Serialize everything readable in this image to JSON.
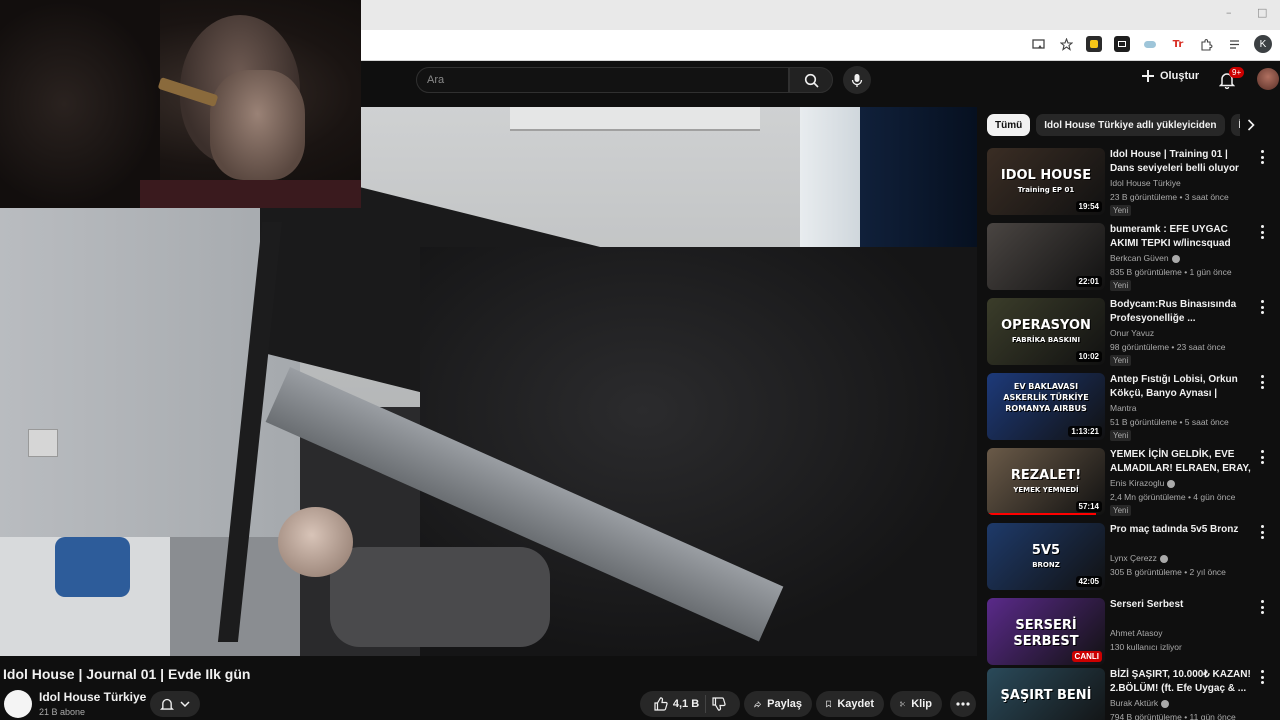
{
  "browser": {
    "window_controls": [
      "–",
      "□"
    ],
    "profile_initial": "K",
    "extensions": [
      "cast-icon",
      "star-icon",
      "ext-yellow-icon",
      "ext-dark-icon",
      "ext-cloud-icon",
      "ext-red-icon",
      "puzzle-icon",
      "tabs-icon"
    ]
  },
  "header": {
    "search_placeholder": "Ara",
    "create_label": "Oluştur",
    "notifications_badge": "9+"
  },
  "video": {
    "title": "Idol House | Journal 01 | Evde Ilk gün",
    "channel": "Idol House Türkiye",
    "subscribers": "21 B abone",
    "likes": "4,1 B",
    "share_label": "Paylaş",
    "save_label": "Kaydet",
    "clip_label": "Klip"
  },
  "sidebar": {
    "chips": [
      "Tümü",
      "Idol House Türkiye adlı yükleyiciden",
      "İl"
    ],
    "recommendations": [
      {
        "title": "Idol House | Training 01 | Dans seviyeleri belli oluyor",
        "channel": "Idol House Türkiye",
        "verified": false,
        "meta": "23 B görüntüleme • 3 saat önce",
        "badge": "Yeni",
        "duration": "19:54",
        "thumb_text": "IDOL HOUSE",
        "thumb_sub": "Training EP 01",
        "thumb_bg": "#3a2d24"
      },
      {
        "title": "bumeramk : EFE UYGAC AKIMI TEPKI w/lincsquad",
        "channel": "Berkcan Güven",
        "verified": true,
        "meta": "835 B görüntüleme • 1 gün önce",
        "badge": "Yeni",
        "duration": "22:01",
        "thumb_text": "",
        "thumb_sub": "",
        "thumb_bg": "#4a4542"
      },
      {
        "title": "Bodycam:Rus Binasısında Profesyonelliğe ...",
        "channel": "Onur Yavuz",
        "verified": false,
        "meta": "98 görüntüleme • 23 saat önce",
        "badge": "Yeni",
        "duration": "10:02",
        "thumb_text": "OPERASYON",
        "thumb_sub": "FABRİKA BASKINI",
        "thumb_bg": "#3b3d2a"
      },
      {
        "title": "Antep Fıstığı Lobisi, Orkun Kökçü, Banyo Aynası | Harman...",
        "channel": "Mantra",
        "verified": false,
        "meta": "51 B görüntüleme • 5 saat önce",
        "badge": "Yeni",
        "duration": "1:13:21",
        "thumb_text": "EV BAKLAVASI ASKERLİK TÜRKİYE ROMANYA AIRBUS",
        "thumb_sub": "",
        "thumb_bg": "#1d3a7a"
      },
      {
        "title": "YEMEK İÇİN GELDİK, EVE ALMADILAR! ELRAEN, ERAY, ...",
        "channel": "Enis Kirazoglu",
        "verified": true,
        "meta": "2,4 Mn görüntüleme • 4 gün önce",
        "badge": "Yeni",
        "duration": "57:14",
        "thumb_text": "REZALET!",
        "thumb_sub": "YEMEK YEMNEDİ",
        "thumb_bg": "#6a5a48"
      },
      {
        "title": "Pro maç tadında 5v5 Bronz",
        "channel": "Lynx Çerezz",
        "verified": true,
        "meta": "305 B görüntüleme • 2 yıl önce",
        "badge": "",
        "duration": "42:05",
        "thumb_text": "5V5",
        "thumb_sub": "BRONZ",
        "thumb_bg": "#1e3a6a"
      },
      {
        "title": "Serseri Serbest",
        "channel": "Ahmet Atasoy",
        "verified": false,
        "meta": "130 kullanıcı izliyor",
        "badge": "",
        "duration": "CANLI",
        "thumb_text": "SERSERİ SERBEST",
        "thumb_sub": "",
        "thumb_bg": "#5a2a8a"
      },
      {
        "title": "BİZİ ŞAŞIRT, 10.000₺ KAZAN! 2.BÖLÜM! (ft. Efe Uygaç & ...",
        "channel": "Burak Aktürk",
        "verified": true,
        "meta": "794 B görüntüleme • 11 gün önce",
        "badge": "",
        "duration": "",
        "thumb_text": "ŞAŞIRT BENİ",
        "thumb_sub": "",
        "thumb_bg": "#2a4a5a"
      }
    ]
  }
}
